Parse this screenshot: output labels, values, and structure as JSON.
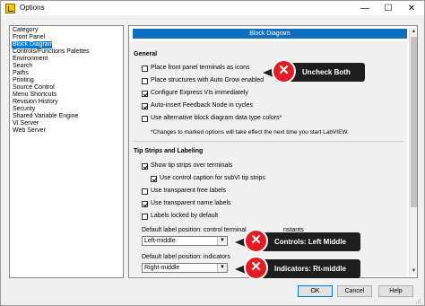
{
  "window": {
    "title": "Options"
  },
  "categories": {
    "header": "Category",
    "items": [
      "Front Panel",
      "Block Diagram",
      "Controls/Functions Palettes",
      "Environment",
      "Search",
      "Paths",
      "Printing",
      "Source Control",
      "Menu Shortcuts",
      "Revision History",
      "Security",
      "Shared Variable Engine",
      "VI Server",
      "Web Server"
    ],
    "selected_index": 1
  },
  "panel": {
    "header": "Block Diagram",
    "general": {
      "title": "General",
      "options": [
        {
          "label": "Place front panel terminals as icons",
          "checked": false
        },
        {
          "label": "Place structures with Auto Grow enabled",
          "checked": false
        },
        {
          "label": "Configure Express VIs immediately",
          "checked": true
        },
        {
          "label": "Auto-insert Feedback Node in cycles",
          "checked": true
        },
        {
          "label": "Use alternative block diagram data type colors*",
          "checked": false
        }
      ],
      "note": "*Changes to marked options will take effect the next time you start LabVIEW."
    },
    "tips": {
      "title": "Tip Strips and Labeling",
      "options": [
        {
          "label": "Show tip strips over terminals",
          "checked": true
        },
        {
          "label": "Use control caption for subVI tip strips",
          "checked": true
        },
        {
          "label": "Use transparent free labels",
          "checked": false
        },
        {
          "label": "Use transparent name labels",
          "checked": true
        },
        {
          "label": "Labels locked by default",
          "checked": false
        }
      ],
      "control_label_position": {
        "label": "Default label position: control terminal",
        "trailing": "nstants",
        "value": "Left-middle"
      },
      "indicator_label_position": {
        "label": "Default label position: indicators",
        "value": "Right-middle"
      }
    }
  },
  "annotations": {
    "uncheck": "Uncheck Both",
    "controls": "Controls: Left Middle",
    "indicators": "Indicators: Rt-middle",
    "x_glyph": "✕"
  },
  "buttons": {
    "ok": "OK",
    "cancel": "Cancel",
    "help": "Help"
  },
  "icons": {
    "minimize": "—",
    "maximize": "☐",
    "close": "✕",
    "arrow_up": "▲",
    "arrow_down": "▼",
    "dropdown": "▼"
  },
  "colors": {
    "accent": "#0078d7",
    "header": "#0e6fbf",
    "callout_bg": "#1e1e1e",
    "callout_x": "#e31b23"
  }
}
